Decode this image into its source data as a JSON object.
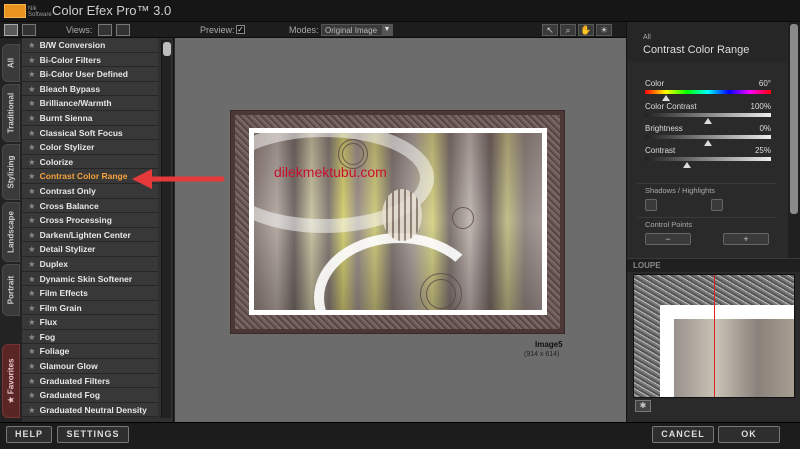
{
  "app": {
    "title": "Color Efex Pro™ 3.0",
    "logo_text": "Nik Software"
  },
  "toolbar": {
    "views_label": "Views:",
    "preview_label": "Preview:",
    "preview_checked": "✓",
    "modes_label": "Modes:",
    "mode_value": "Original Image",
    "tools": [
      "arrow-tool",
      "zoom-tool",
      "hand-tool",
      "light-tool"
    ]
  },
  "tabs": [
    {
      "label": "All"
    },
    {
      "label": "Traditional"
    },
    {
      "label": "Stylizing"
    },
    {
      "label": "Landscape"
    },
    {
      "label": "Portrait"
    },
    {
      "label": "★ Favorites"
    }
  ],
  "filters": [
    "B/W Conversion",
    "Bi-Color Filters",
    "Bi-Color User Defined",
    "Bleach Bypass",
    "Brilliance/Warmth",
    "Burnt Sienna",
    "Classical Soft Focus",
    "Color Stylizer",
    "Colorize",
    "Contrast Color Range",
    "Contrast Only",
    "Cross Balance",
    "Cross Processing",
    "Darken/Lighten Center",
    "Detail Stylizer",
    "Duplex",
    "Dynamic Skin Softener",
    "Film Effects",
    "Film Grain",
    "Flux",
    "Fog",
    "Foliage",
    "Glamour Glow",
    "Graduated Filters",
    "Graduated Fog",
    "Graduated Neutral Density"
  ],
  "selected_filter": "Contrast Color Range",
  "preview": {
    "watermark": "dilekmektubu.com",
    "image_name": "Image5",
    "image_size": "(914 x 614)"
  },
  "panel": {
    "category": "All",
    "title": "Contrast Color Range",
    "params": [
      {
        "label": "Color",
        "value": "60°",
        "position": 0.17
      },
      {
        "label": "Color Contrast",
        "value": "100%",
        "position": 0.5
      },
      {
        "label": "Brightness",
        "value": "0%",
        "position": 0.5
      },
      {
        "label": "Contrast",
        "value": "25%",
        "position": 0.33
      }
    ],
    "shadows_label": "Shadows / Highlights",
    "control_points_label": "Control Points",
    "loupe_label": "LOUPE"
  },
  "bottom": {
    "help": "HELP",
    "settings": "SETTINGS",
    "cancel": "CANCEL",
    "ok": "OK"
  },
  "colors": {
    "selected_text": "#f7a33b",
    "arrow": "#e63a3a",
    "watermark": "#c8102e"
  }
}
